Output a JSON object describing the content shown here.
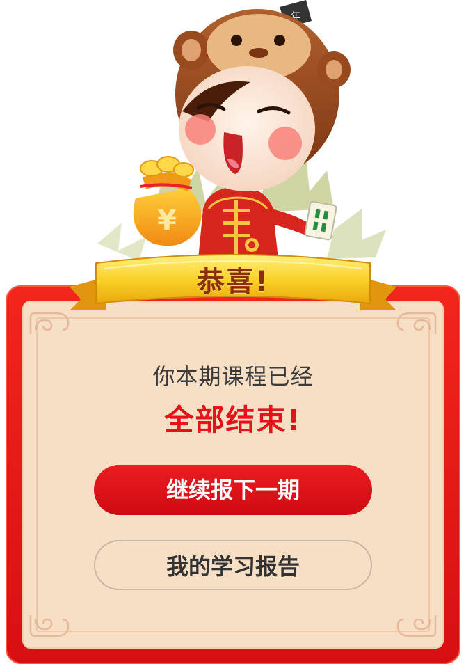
{
  "banner": {
    "title": "恭喜!"
  },
  "message": {
    "line1": "你本期课程已经",
    "line2": "全部结束!"
  },
  "buttons": {
    "primary_label": "继续报下一期",
    "secondary_label": "我的学习报告"
  },
  "colors": {
    "card_red": "#e41a17",
    "panel_beige": "#f7dfc6",
    "headline_red": "#e4121a",
    "ribbon_gold": "#f6c51c"
  },
  "illustration": {
    "character": "monkey-hat-kid-icon",
    "money_bag_symbol": "¥",
    "mahjong_tile": "mahjong-tile-icon"
  }
}
